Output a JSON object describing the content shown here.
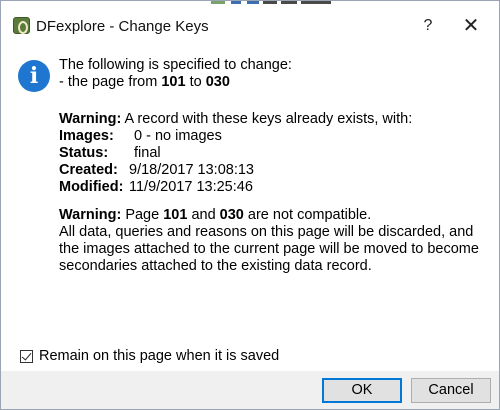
{
  "window": {
    "title": "DFexplore - Change Keys",
    "help_glyph": "?",
    "close_glyph": "✕"
  },
  "icons": {
    "app": "dfexplore-app-icon",
    "info": "info-icon",
    "info_glyph": "i"
  },
  "intro": {
    "line1": "The following is specified to change:",
    "line2_prefix": "- the page from ",
    "from_page": "101",
    "line2_mid": " to ",
    "to_page": "030"
  },
  "warning1": {
    "label": "Warning:",
    "text": " A record with these keys already exists, with:"
  },
  "record": {
    "images_label": "Images:",
    "images_value": "0 - no images",
    "status_label": "Status:",
    "status_value": "final",
    "created_label": "Created:",
    "created_value": "9/18/2017 13:08:13",
    "modified_label": "Modified:",
    "modified_value": "11/9/2017 13:25:46"
  },
  "warning2": {
    "label": "Warning:",
    "prefix": " Page ",
    "page_a": "101",
    "mid": " and ",
    "page_b": "030",
    "suffix": " are not compatible.",
    "body": "All data, queries and reasons on this page will be discarded, and the images attached to the current page will be moved to become secondaries attached to the existing data record."
  },
  "checkbox": {
    "checked": true,
    "label": "Remain on this page when it is saved"
  },
  "buttons": {
    "ok": "OK",
    "cancel": "Cancel"
  }
}
